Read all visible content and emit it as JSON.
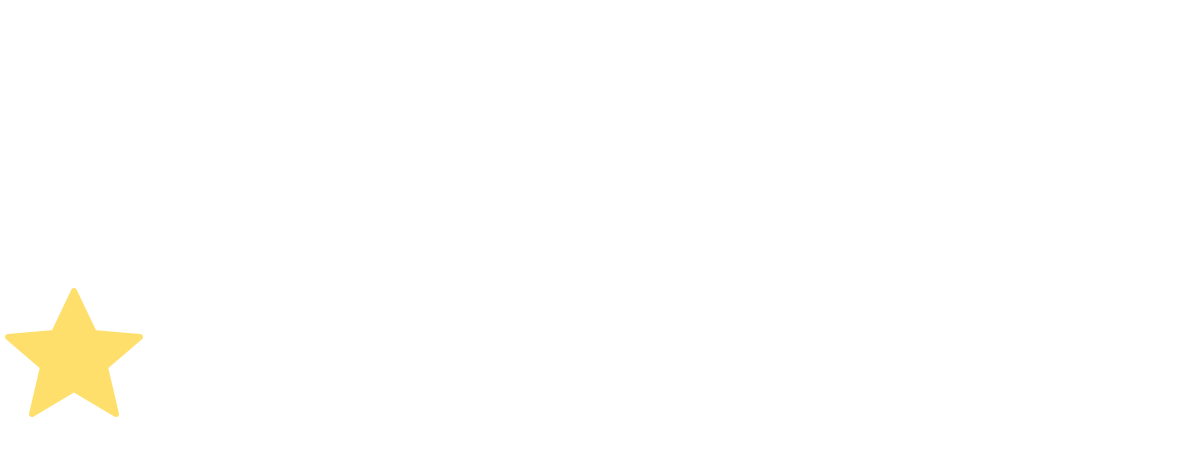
{
  "background_color": "#ffffff",
  "star": {
    "icon": "star-icon",
    "color": "#FFDF6C"
  }
}
